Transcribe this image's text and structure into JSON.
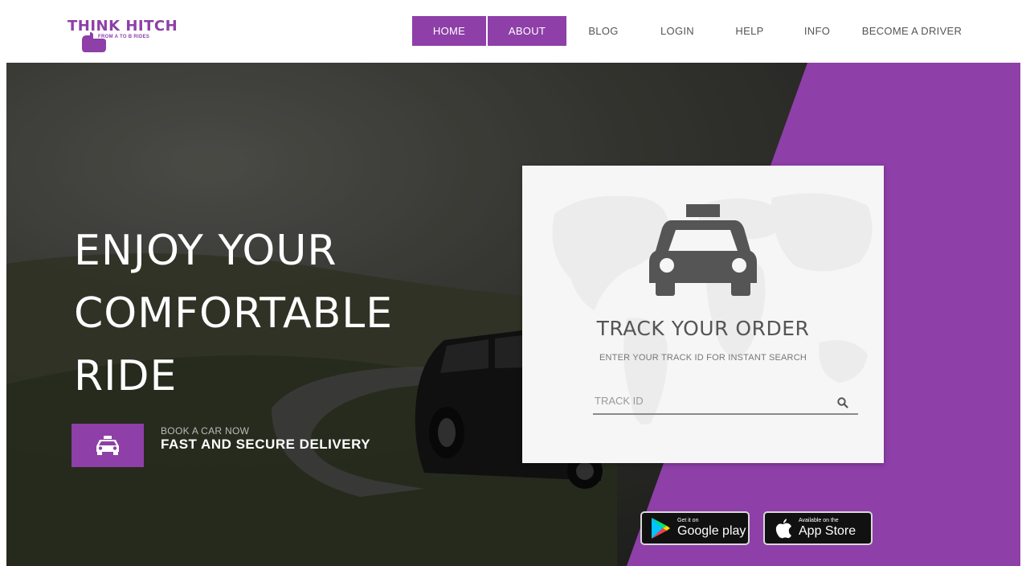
{
  "logo": {
    "title": "THINK HITCH",
    "tagline": "FROM A TO B RIDES"
  },
  "nav": {
    "items": [
      {
        "label": "HOME",
        "active": true
      },
      {
        "label": "ABOUT",
        "active": true
      },
      {
        "label": "BLOG",
        "active": false
      },
      {
        "label": "LOGIN",
        "active": false
      },
      {
        "label": "HELP",
        "active": false
      },
      {
        "label": "INFO",
        "active": false
      },
      {
        "label": "BECOME A DRIVER",
        "active": false
      }
    ]
  },
  "hero": {
    "title_lines": [
      "ENJOY YOUR",
      "COMFORTABLE",
      "RIDE"
    ],
    "book_small": "BOOK A CAR NOW",
    "book_big": "FAST AND SECURE DELIVERY",
    "book_icon": "taxi-icon"
  },
  "track": {
    "title": "TRACK YOUR ORDER",
    "subtitle": "ENTER YOUR TRACK ID FOR INSTANT SEARCH",
    "input_placeholder": "TRACK ID",
    "input_value": "",
    "icon": "taxi-icon",
    "search_icon": "search-icon"
  },
  "badges": {
    "google": {
      "small": "Get it on",
      "big": "Google play",
      "icon": "google-play-icon"
    },
    "apple": {
      "small": "Available on the",
      "big": "App Store",
      "icon": "apple-icon"
    }
  },
  "colors": {
    "accent": "#8e3fa8",
    "dark": "#2d2d2a",
    "card": "#f6f6f6"
  }
}
